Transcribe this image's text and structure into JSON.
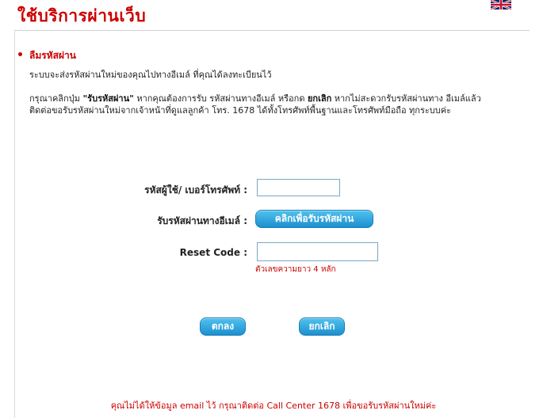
{
  "header": {
    "title": "ใช้บริการผ่านเว็บ",
    "language_icon": "uk-flag-icon"
  },
  "section": {
    "heading": "ลืมรหัสผ่าน",
    "intro": "ระบบจะส่งรหัสผ่านใหม่ของคุณไปทางอีเมล์ ที่คุณได้ลงทะเบียนไว้",
    "instructions": {
      "part1": "กรุณาคลิกปุ่ม ",
      "bold1": "\"รับรหัสผ่าน\"",
      "part2": " หากคุณต้องการรับ รหัสผ่านทางอีเมล์ หรือกด ",
      "bold2": "ยกเลิก",
      "part3": " หากไม่สะดวกรับรหัสผ่านทาง อีเมล์แล้ว ติดต่อขอรับรหัสผ่านใหม่จากเจ้าหน้าที่ดูแลลูกค้า โทร. 1678 ได้ทั้งโทรศัพท์พื้นฐานและโทรศัพท์มือถือ ทุกระบบค่ะ"
    }
  },
  "form": {
    "username_label": "รหัสผู้ใช้/ เบอร์โทรศัพท์ :",
    "username_value": "",
    "email_label": "รับรหัสผ่านทางอีเมล์ :",
    "get_code_button": "คลิกเพื่อรับรหัสผ่าน",
    "reset_label": "Reset Code :",
    "reset_value": "",
    "reset_hint": "ตัวเลขความยาว 4 หลัก",
    "ok_button": "ตกลง",
    "cancel_button": "ยกเลิก"
  },
  "footer": {
    "note": "คุณไม่ได้ให้ข้อมูล email ไว้ กรุณาติดต่อ Call Center 1678 เพื่อขอรับรหัสผ่านใหม่ค่ะ"
  },
  "colors": {
    "accent_red": "#cc0000",
    "button_blue": "#1d8fcf"
  }
}
